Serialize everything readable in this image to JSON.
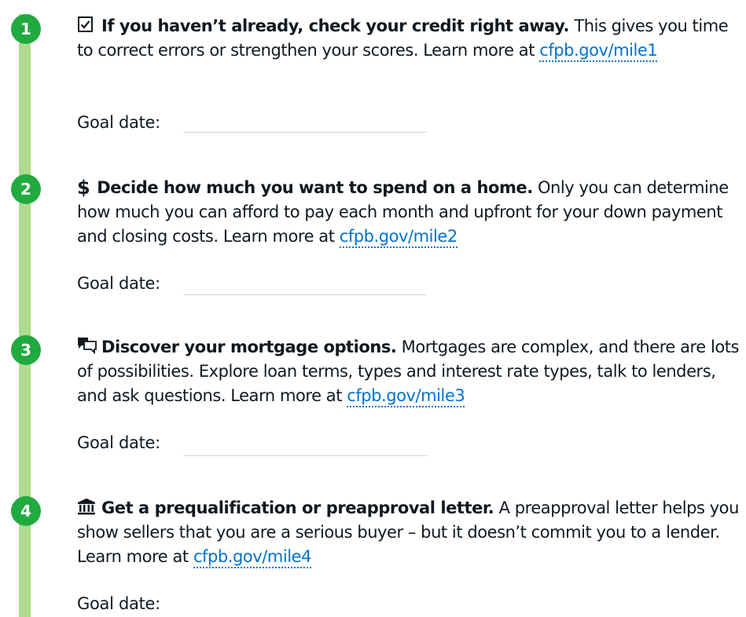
{
  "steps": [
    {
      "number": "1",
      "icon": "checkbox-icon",
      "title": "If you haven’t already, check your credit right away.",
      "body": "This gives you time to correct errors or strengthen your scores. Learn more at",
      "link": "cfpb.gov/mile1",
      "goal_label": "Goal date:",
      "goal_value": ""
    },
    {
      "number": "2",
      "icon": "dollar-icon",
      "title": "Decide how much you want to spend on a home.",
      "body": "Only you can determine how much you can afford to pay each month and upfront for your down payment and closing costs. Learn more at",
      "link": "cfpb.gov/mile2",
      "goal_label": "Goal date:",
      "goal_value": ""
    },
    {
      "number": "3",
      "icon": "chat-bubbles-icon",
      "title": "Discover your mortgage options.",
      "body": "Mortgages are complex, and there are lots of possibilities. Explore loan terms, types and interest rate types, talk to lenders, and ask questions. Learn more at",
      "link": "cfpb.gov/mile3",
      "goal_label": "Goal date:",
      "goal_value": ""
    },
    {
      "number": "4",
      "icon": "bank-icon",
      "title": "Get a prequalification or preapproval letter.",
      "body": "A preapproval letter helps you show sellers that you are a serious buyer – but it doesn’t commit you to a lender. Learn more at",
      "link": "cfpb.gov/mile4",
      "goal_label": "Goal date:",
      "goal_value": ""
    }
  ],
  "colors": {
    "timeline": "#addc91",
    "badge": "#20aa3f",
    "link": "#0072ce",
    "text": "#101820"
  }
}
